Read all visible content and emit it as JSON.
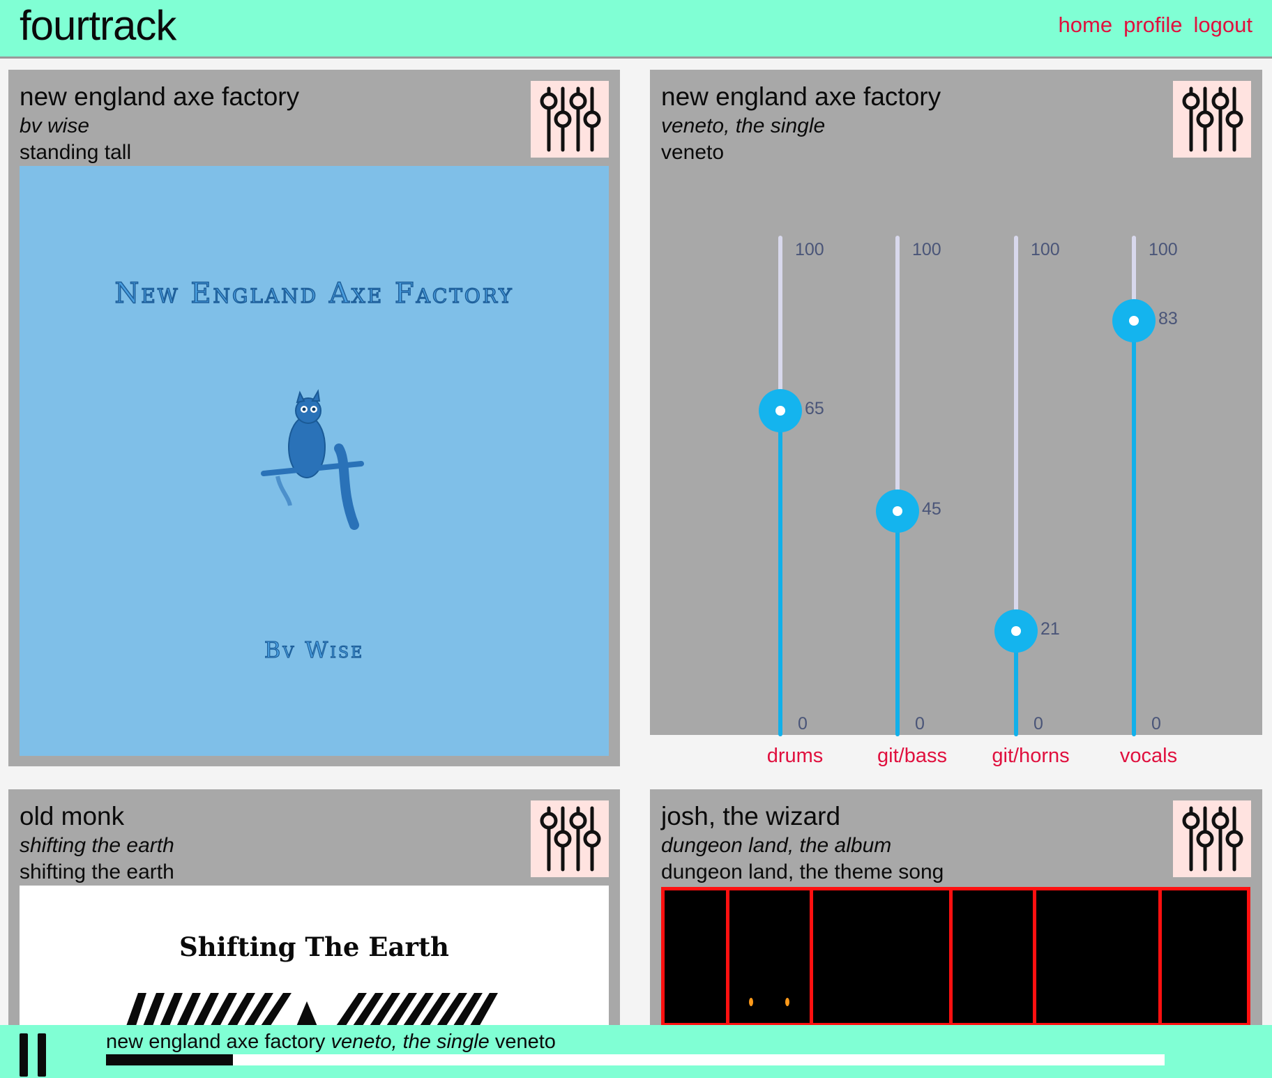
{
  "app": {
    "logo": "fourtrack",
    "nav": [
      "home",
      "profile",
      "logout"
    ]
  },
  "cards": [
    {
      "title": "new england axe factory",
      "album": "bv wise",
      "song": "standing tall",
      "mixer_icon": "mixer-sliders-icon",
      "art": {
        "type": "album-art",
        "title": "New England Axe Factory",
        "artist": "Bv Wise",
        "bg": "#7fbfe8"
      }
    },
    {
      "title": "new england axe factory",
      "album": "veneto, the single",
      "song": "veneto",
      "mixer_icon": "mixer-sliders-icon",
      "mixer": {
        "max_label": "100",
        "min_label": "0",
        "channels": [
          {
            "name": "drums",
            "value": 65
          },
          {
            "name": "git/bass",
            "value": 45
          },
          {
            "name": "git/horns",
            "value": 21
          },
          {
            "name": "vocals",
            "value": 83
          }
        ]
      }
    },
    {
      "title": "old monk",
      "album": "shifting the earth",
      "song": "shifting the earth",
      "mixer_icon": "mixer-sliders-icon",
      "art": {
        "type": "album-art",
        "title": "Shifting The Earth",
        "bg": "#ffffff"
      }
    },
    {
      "title": "josh, the wizard",
      "album": "dungeon land, the album",
      "song": "dungeon land, the theme song",
      "mixer_icon": "mixer-sliders-icon",
      "art": {
        "type": "game-scene",
        "bg": "#000000",
        "accent": "#ff1010"
      }
    }
  ],
  "player": {
    "title": "new england axe factory",
    "album": "veneto, the single",
    "song": "veneto",
    "progress": 0.12,
    "pause_icon": "pause-icon"
  },
  "colors": {
    "header_bg": "#80ffd4",
    "link": "#e0103e",
    "card_bg": "#a8a8a8",
    "slider_fill": "#11b0ea",
    "slider_track": "#d8d8ec",
    "mixer_button_bg": "#ffe3e0"
  }
}
